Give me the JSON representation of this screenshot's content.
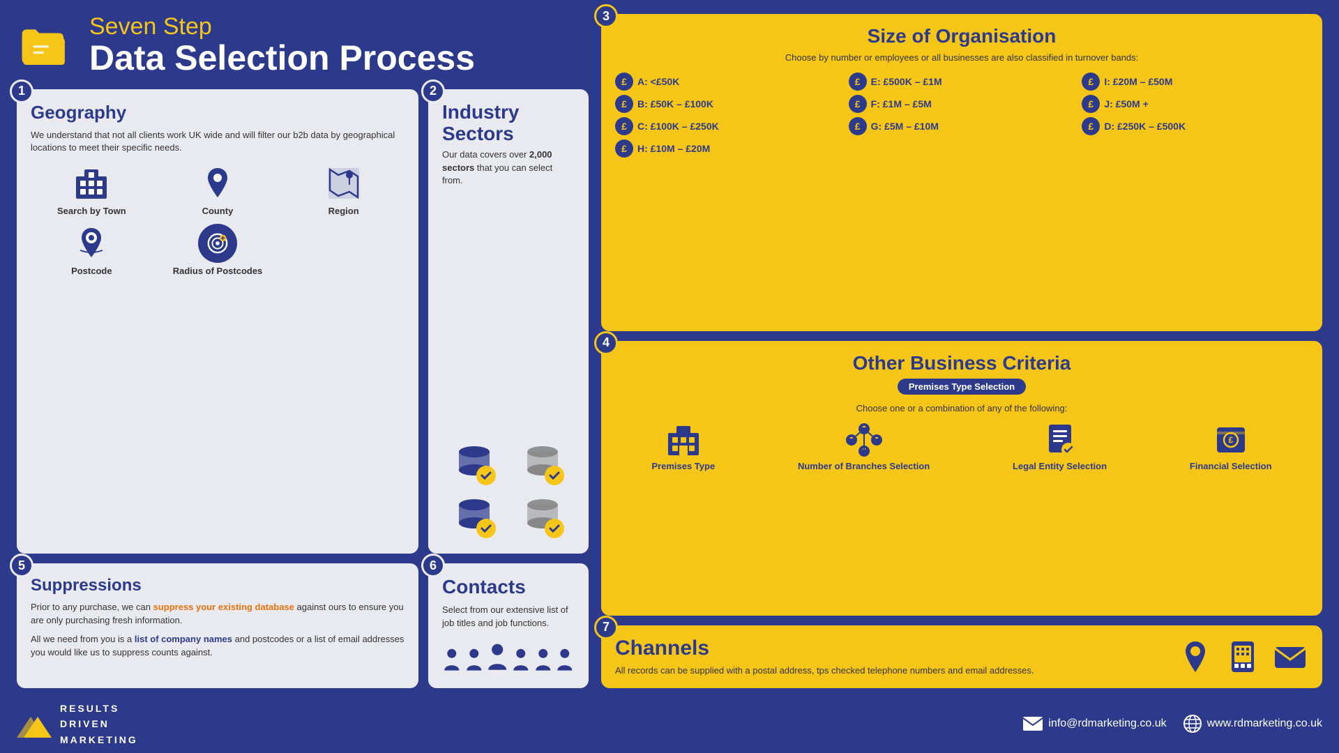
{
  "header": {
    "subtitle": "Seven Step",
    "title": "Data Selection Process"
  },
  "steps": {
    "geography": {
      "step": "1",
      "title": "Geography",
      "description": "We understand that not all clients work UK wide and will filter our b2b data by geographical locations to meet their specific needs.",
      "items": [
        {
          "label": "Search by Town"
        },
        {
          "label": "County"
        },
        {
          "label": "Region"
        },
        {
          "label": "Postcode"
        },
        {
          "label": "Radius of Postcodes"
        }
      ]
    },
    "industry": {
      "step": "2",
      "title": "Industry Sectors",
      "description": "Our data covers over 2,000 sectors that you can select from.",
      "bold": "2,000"
    },
    "size": {
      "step": "3",
      "title": "Size of Organisation",
      "subtitle": "Choose by number or employees or all businesses are also classified in turnover bands:",
      "bands": [
        {
          "label": "A: <£50K"
        },
        {
          "label": "B: £50K – £100K"
        },
        {
          "label": "C: £100K – £250K"
        },
        {
          "label": "D: £250K – £500K"
        },
        {
          "label": "E: £500K – £1M"
        },
        {
          "label": "F: £1M – £5M"
        },
        {
          "label": "G: £5M – £10M"
        },
        {
          "label": "H: £10M – £20M"
        },
        {
          "label": "I: £20M – £50M"
        },
        {
          "label": "J: £50M +"
        }
      ]
    },
    "criteria": {
      "step": "4",
      "title": "Other Business Criteria",
      "badge": "Premises Type Selection",
      "subtitle": "Choose one or a combination of any of the following:",
      "items": [
        {
          "label": "Premises Type"
        },
        {
          "label": "Number of Branches Selection"
        },
        {
          "label": "Legal Entity Selection"
        },
        {
          "label": "Financial Selection"
        }
      ]
    },
    "suppressions": {
      "step": "5",
      "title": "Suppressions",
      "para1": "Prior to any purchase, we can suppress your existing database against ours to ensure you are only purchasing fresh information.",
      "para1_highlight": "suppress your existing database",
      "para2_before": "All we need from you is a ",
      "para2_link": "list of company names",
      "para2_after": " and postcodes or a list of email addresses you would like us to suppress counts against."
    },
    "contacts": {
      "step": "6",
      "title": "Contacts",
      "description": "Select from our extensive list of job titles and job functions."
    },
    "channels": {
      "step": "7",
      "title": "Channels",
      "description": "All records can be supplied with a postal address, tps checked telephone numbers and email addresses."
    }
  },
  "footer": {
    "logo_lines": [
      "RESULTS",
      "DRIVEN",
      "MARKETING"
    ],
    "email": "info@rdmarketing.co.uk",
    "website": "www.rdmarketing.co.uk"
  }
}
